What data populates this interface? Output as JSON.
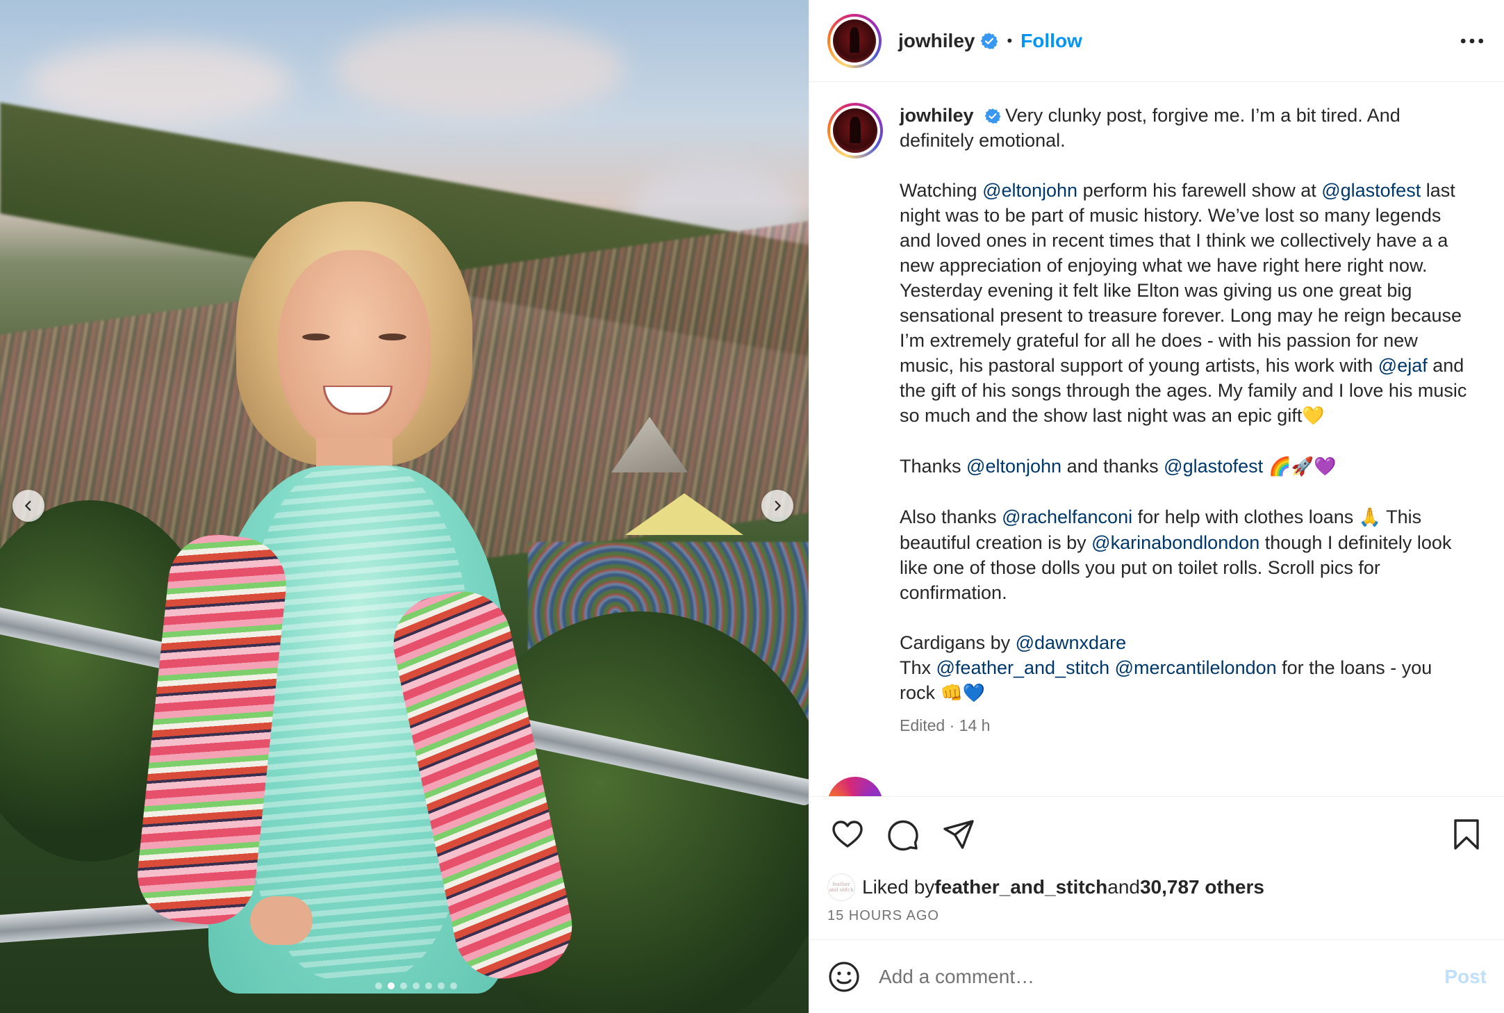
{
  "post": {
    "username": "jowhiley",
    "verified": true,
    "follow_label": "Follow",
    "separator": "•",
    "more_label": "•••",
    "media": {
      "slide_index": 1,
      "slide_count": 7,
      "prev_icon": "chevron-left-icon",
      "next_icon": "chevron-right-icon"
    }
  },
  "caption": {
    "username": "jowhiley",
    "p1": "Very clunky post, forgive me. I’m a bit tired. And definitely emotional.",
    "p2": {
      "t1": "Watching ",
      "m1": "@eltonjohn",
      "t2": " perform his farewell show at ",
      "m2": "@glastofest",
      "t3": " last night was to be part of music history. We’ve lost so many legends and loved ones in recent times that I think we collectively have a a new appreciation of enjoying what we have right here right now. Yesterday evening it felt like Elton was giving us one great big sensational present to treasure forever. Long may he reign because I’m extremely grateful for all he does - with his passion for new music, his pastoral support of young artists, his work with ",
      "m3": "@ejaf",
      "t4": " and the gift of his songs through the ages. My family and I love his music so much and the show last night was an epic gift",
      "e1": "💛"
    },
    "p3": {
      "t1": "Thanks ",
      "m1": "@eltonjohn",
      "t2": " and thanks ",
      "m2": "@glastofest",
      "e1": " 🌈🚀💜"
    },
    "p4": {
      "t1": "Also thanks ",
      "m1": "@rachelfanconi",
      "t2": " for help with clothes loans ",
      "e1": "🙏",
      "t3": " This beautiful creation is by ",
      "m2": "@karinabondlondon",
      "t4": " though I definitely look like one of those dolls you put on toilet rolls. Scroll pics for confirmation."
    },
    "p5": {
      "t1": "Cardigans by ",
      "m1": "@dawnxdare",
      "t2": "Thx ",
      "m2": "@feather_and_stitch",
      "m3": "@mercantilelondon",
      "t3": " for the loans - you rock ",
      "e1": "👊💙"
    },
    "meta": "Edited · 14 h"
  },
  "actions": {
    "like_icon": "heart-icon",
    "comment_icon": "comment-icon",
    "share_icon": "share-icon",
    "save_icon": "bookmark-icon"
  },
  "likes": {
    "prefix": "Liked by ",
    "user": "feather_and_stitch",
    "middle": " and ",
    "others": "30,787 others",
    "liker_avatar_text": "feather and stitch"
  },
  "timestamp": "15 HOURS AGO",
  "comment_box": {
    "placeholder": "Add a comment…",
    "post_label": "Post"
  },
  "colors": {
    "accent": "#0095f6",
    "mention": "#00376b",
    "post_disabled": "#c0dffd",
    "muted": "#737373"
  }
}
